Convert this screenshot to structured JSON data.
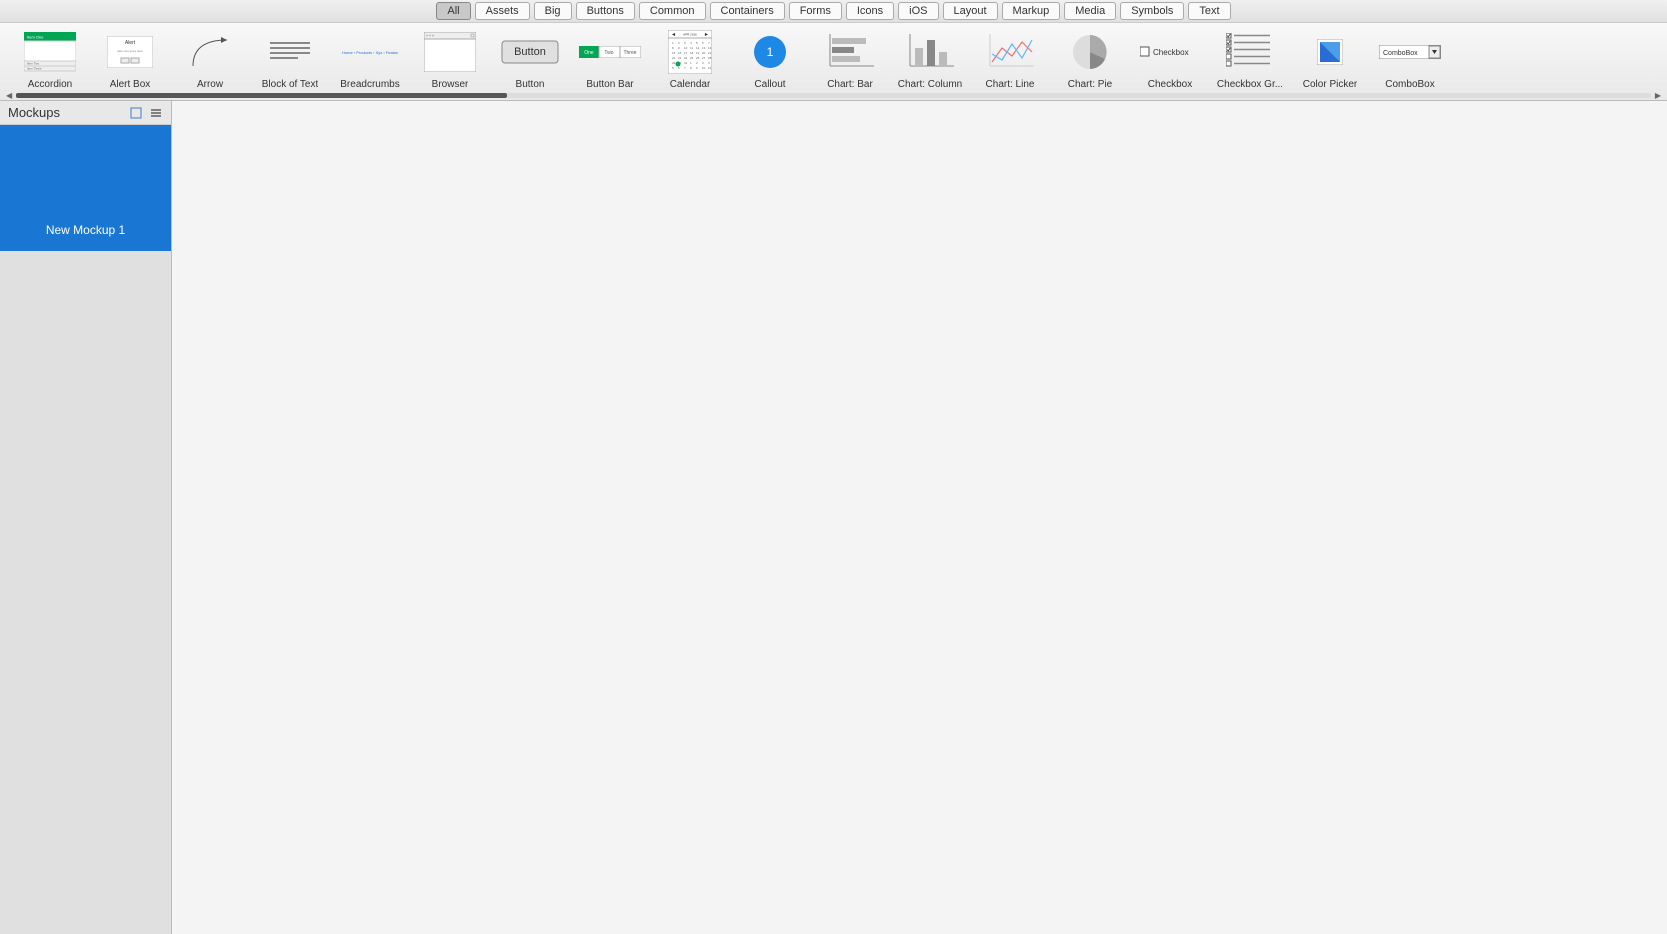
{
  "categories": [
    {
      "label": "All",
      "active": true
    },
    {
      "label": "Assets",
      "active": false
    },
    {
      "label": "Big",
      "active": false
    },
    {
      "label": "Buttons",
      "active": false
    },
    {
      "label": "Common",
      "active": false
    },
    {
      "label": "Containers",
      "active": false
    },
    {
      "label": "Forms",
      "active": false
    },
    {
      "label": "Icons",
      "active": false
    },
    {
      "label": "iOS",
      "active": false
    },
    {
      "label": "Layout",
      "active": false
    },
    {
      "label": "Markup",
      "active": false
    },
    {
      "label": "Media",
      "active": false
    },
    {
      "label": "Symbols",
      "active": false
    },
    {
      "label": "Text",
      "active": false
    }
  ],
  "gallery": [
    {
      "label": "Accordion"
    },
    {
      "label": "Alert Box"
    },
    {
      "label": "Arrow"
    },
    {
      "label": "Block of Text"
    },
    {
      "label": "Breadcrumbs"
    },
    {
      "label": "Browser"
    },
    {
      "label": "Button"
    },
    {
      "label": "Button Bar"
    },
    {
      "label": "Calendar"
    },
    {
      "label": "Callout"
    },
    {
      "label": "Chart: Bar"
    },
    {
      "label": "Chart: Column"
    },
    {
      "label": "Chart: Line"
    },
    {
      "label": "Chart: Pie"
    },
    {
      "label": "Checkbox"
    },
    {
      "label": "Checkbox Gr..."
    },
    {
      "label": "Color Picker"
    },
    {
      "label": "ComboBox"
    }
  ],
  "sidebar": {
    "title": "Mockups",
    "items": [
      {
        "label": "New Mockup 1",
        "selected": true
      }
    ]
  },
  "callout_number": "1",
  "button_label": "Button",
  "buttonbar_labels": [
    "One",
    "Two",
    "Three"
  ],
  "checkbox_label": "Checkbox",
  "combobox_label": "ComboBox",
  "alert_title": "Alert",
  "colors": {
    "accent_blue": "#1976d2",
    "accent_green": "#00a653"
  }
}
